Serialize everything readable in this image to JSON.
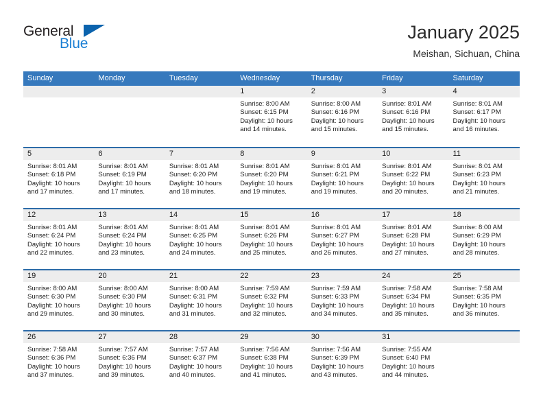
{
  "brand": {
    "name_part1": "General",
    "name_part2": "Blue",
    "triangle_color": "#0b63ad",
    "blue_text_color": "#1a7fd4"
  },
  "header": {
    "title": "January 2025",
    "subtitle": "Meishan, Sichuan, China"
  },
  "theme": {
    "header_blue": "#3679bd",
    "row_divider_blue": "#2d6ca9",
    "daynum_band": "#ededed"
  },
  "weekdays": [
    "Sunday",
    "Monday",
    "Tuesday",
    "Wednesday",
    "Thursday",
    "Friday",
    "Saturday"
  ],
  "weeks": [
    [
      {
        "empty": true,
        "day": "",
        "sunrise": "",
        "sunset": "",
        "daylight_line1": "",
        "daylight_line2": ""
      },
      {
        "empty": true,
        "day": "",
        "sunrise": "",
        "sunset": "",
        "daylight_line1": "",
        "daylight_line2": ""
      },
      {
        "empty": true,
        "day": "",
        "sunrise": "",
        "sunset": "",
        "daylight_line1": "",
        "daylight_line2": ""
      },
      {
        "empty": false,
        "day": "1",
        "sunrise": "Sunrise: 8:00 AM",
        "sunset": "Sunset: 6:15 PM",
        "daylight_line1": "Daylight: 10 hours",
        "daylight_line2": "and 14 minutes."
      },
      {
        "empty": false,
        "day": "2",
        "sunrise": "Sunrise: 8:00 AM",
        "sunset": "Sunset: 6:16 PM",
        "daylight_line1": "Daylight: 10 hours",
        "daylight_line2": "and 15 minutes."
      },
      {
        "empty": false,
        "day": "3",
        "sunrise": "Sunrise: 8:01 AM",
        "sunset": "Sunset: 6:16 PM",
        "daylight_line1": "Daylight: 10 hours",
        "daylight_line2": "and 15 minutes."
      },
      {
        "empty": false,
        "day": "4",
        "sunrise": "Sunrise: 8:01 AM",
        "sunset": "Sunset: 6:17 PM",
        "daylight_line1": "Daylight: 10 hours",
        "daylight_line2": "and 16 minutes."
      }
    ],
    [
      {
        "empty": false,
        "day": "5",
        "sunrise": "Sunrise: 8:01 AM",
        "sunset": "Sunset: 6:18 PM",
        "daylight_line1": "Daylight: 10 hours",
        "daylight_line2": "and 17 minutes."
      },
      {
        "empty": false,
        "day": "6",
        "sunrise": "Sunrise: 8:01 AM",
        "sunset": "Sunset: 6:19 PM",
        "daylight_line1": "Daylight: 10 hours",
        "daylight_line2": "and 17 minutes."
      },
      {
        "empty": false,
        "day": "7",
        "sunrise": "Sunrise: 8:01 AM",
        "sunset": "Sunset: 6:20 PM",
        "daylight_line1": "Daylight: 10 hours",
        "daylight_line2": "and 18 minutes."
      },
      {
        "empty": false,
        "day": "8",
        "sunrise": "Sunrise: 8:01 AM",
        "sunset": "Sunset: 6:20 PM",
        "daylight_line1": "Daylight: 10 hours",
        "daylight_line2": "and 19 minutes."
      },
      {
        "empty": false,
        "day": "9",
        "sunrise": "Sunrise: 8:01 AM",
        "sunset": "Sunset: 6:21 PM",
        "daylight_line1": "Daylight: 10 hours",
        "daylight_line2": "and 19 minutes."
      },
      {
        "empty": false,
        "day": "10",
        "sunrise": "Sunrise: 8:01 AM",
        "sunset": "Sunset: 6:22 PM",
        "daylight_line1": "Daylight: 10 hours",
        "daylight_line2": "and 20 minutes."
      },
      {
        "empty": false,
        "day": "11",
        "sunrise": "Sunrise: 8:01 AM",
        "sunset": "Sunset: 6:23 PM",
        "daylight_line1": "Daylight: 10 hours",
        "daylight_line2": "and 21 minutes."
      }
    ],
    [
      {
        "empty": false,
        "day": "12",
        "sunrise": "Sunrise: 8:01 AM",
        "sunset": "Sunset: 6:24 PM",
        "daylight_line1": "Daylight: 10 hours",
        "daylight_line2": "and 22 minutes."
      },
      {
        "empty": false,
        "day": "13",
        "sunrise": "Sunrise: 8:01 AM",
        "sunset": "Sunset: 6:24 PM",
        "daylight_line1": "Daylight: 10 hours",
        "daylight_line2": "and 23 minutes."
      },
      {
        "empty": false,
        "day": "14",
        "sunrise": "Sunrise: 8:01 AM",
        "sunset": "Sunset: 6:25 PM",
        "daylight_line1": "Daylight: 10 hours",
        "daylight_line2": "and 24 minutes."
      },
      {
        "empty": false,
        "day": "15",
        "sunrise": "Sunrise: 8:01 AM",
        "sunset": "Sunset: 6:26 PM",
        "daylight_line1": "Daylight: 10 hours",
        "daylight_line2": "and 25 minutes."
      },
      {
        "empty": false,
        "day": "16",
        "sunrise": "Sunrise: 8:01 AM",
        "sunset": "Sunset: 6:27 PM",
        "daylight_line1": "Daylight: 10 hours",
        "daylight_line2": "and 26 minutes."
      },
      {
        "empty": false,
        "day": "17",
        "sunrise": "Sunrise: 8:01 AM",
        "sunset": "Sunset: 6:28 PM",
        "daylight_line1": "Daylight: 10 hours",
        "daylight_line2": "and 27 minutes."
      },
      {
        "empty": false,
        "day": "18",
        "sunrise": "Sunrise: 8:00 AM",
        "sunset": "Sunset: 6:29 PM",
        "daylight_line1": "Daylight: 10 hours",
        "daylight_line2": "and 28 minutes."
      }
    ],
    [
      {
        "empty": false,
        "day": "19",
        "sunrise": "Sunrise: 8:00 AM",
        "sunset": "Sunset: 6:30 PM",
        "daylight_line1": "Daylight: 10 hours",
        "daylight_line2": "and 29 minutes."
      },
      {
        "empty": false,
        "day": "20",
        "sunrise": "Sunrise: 8:00 AM",
        "sunset": "Sunset: 6:30 PM",
        "daylight_line1": "Daylight: 10 hours",
        "daylight_line2": "and 30 minutes."
      },
      {
        "empty": false,
        "day": "21",
        "sunrise": "Sunrise: 8:00 AM",
        "sunset": "Sunset: 6:31 PM",
        "daylight_line1": "Daylight: 10 hours",
        "daylight_line2": "and 31 minutes."
      },
      {
        "empty": false,
        "day": "22",
        "sunrise": "Sunrise: 7:59 AM",
        "sunset": "Sunset: 6:32 PM",
        "daylight_line1": "Daylight: 10 hours",
        "daylight_line2": "and 32 minutes."
      },
      {
        "empty": false,
        "day": "23",
        "sunrise": "Sunrise: 7:59 AM",
        "sunset": "Sunset: 6:33 PM",
        "daylight_line1": "Daylight: 10 hours",
        "daylight_line2": "and 34 minutes."
      },
      {
        "empty": false,
        "day": "24",
        "sunrise": "Sunrise: 7:58 AM",
        "sunset": "Sunset: 6:34 PM",
        "daylight_line1": "Daylight: 10 hours",
        "daylight_line2": "and 35 minutes."
      },
      {
        "empty": false,
        "day": "25",
        "sunrise": "Sunrise: 7:58 AM",
        "sunset": "Sunset: 6:35 PM",
        "daylight_line1": "Daylight: 10 hours",
        "daylight_line2": "and 36 minutes."
      }
    ],
    [
      {
        "empty": false,
        "day": "26",
        "sunrise": "Sunrise: 7:58 AM",
        "sunset": "Sunset: 6:36 PM",
        "daylight_line1": "Daylight: 10 hours",
        "daylight_line2": "and 37 minutes."
      },
      {
        "empty": false,
        "day": "27",
        "sunrise": "Sunrise: 7:57 AM",
        "sunset": "Sunset: 6:36 PM",
        "daylight_line1": "Daylight: 10 hours",
        "daylight_line2": "and 39 minutes."
      },
      {
        "empty": false,
        "day": "28",
        "sunrise": "Sunrise: 7:57 AM",
        "sunset": "Sunset: 6:37 PM",
        "daylight_line1": "Daylight: 10 hours",
        "daylight_line2": "and 40 minutes."
      },
      {
        "empty": false,
        "day": "29",
        "sunrise": "Sunrise: 7:56 AM",
        "sunset": "Sunset: 6:38 PM",
        "daylight_line1": "Daylight: 10 hours",
        "daylight_line2": "and 41 minutes."
      },
      {
        "empty": false,
        "day": "30",
        "sunrise": "Sunrise: 7:56 AM",
        "sunset": "Sunset: 6:39 PM",
        "daylight_line1": "Daylight: 10 hours",
        "daylight_line2": "and 43 minutes."
      },
      {
        "empty": false,
        "day": "31",
        "sunrise": "Sunrise: 7:55 AM",
        "sunset": "Sunset: 6:40 PM",
        "daylight_line1": "Daylight: 10 hours",
        "daylight_line2": "and 44 minutes."
      },
      {
        "empty": true,
        "day": "",
        "sunrise": "",
        "sunset": "",
        "daylight_line1": "",
        "daylight_line2": ""
      }
    ]
  ]
}
